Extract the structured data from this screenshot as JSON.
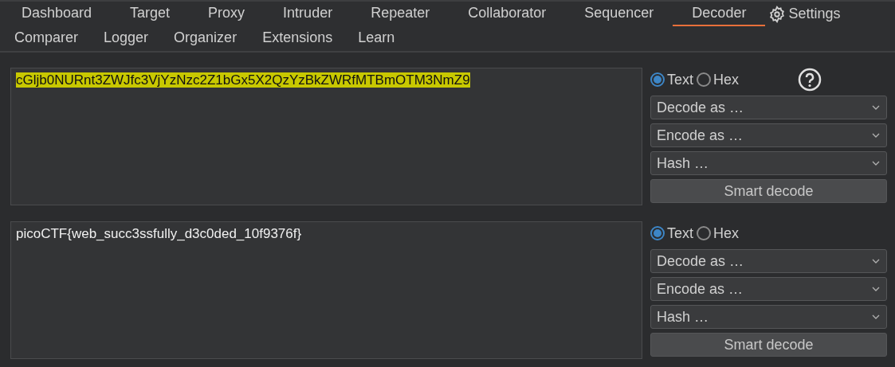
{
  "tabs_row_1": [
    {
      "label": "Dashboard",
      "selected": false
    },
    {
      "label": "Target",
      "selected": false
    },
    {
      "label": "Proxy",
      "selected": false
    },
    {
      "label": "Intruder",
      "selected": false
    },
    {
      "label": "Repeater",
      "selected": false
    },
    {
      "label": "Collaborator",
      "selected": false
    },
    {
      "label": "Sequencer",
      "selected": false
    },
    {
      "label": "Decoder",
      "selected": true
    }
  ],
  "settings": {
    "label": "Settings"
  },
  "tabs_row_2": [
    {
      "label": "Comparer",
      "selected": false
    },
    {
      "label": "Logger",
      "selected": false
    },
    {
      "label": "Organizer",
      "selected": false
    },
    {
      "label": "Extensions",
      "selected": false
    },
    {
      "label": "Learn",
      "selected": false
    }
  ],
  "panels": [
    {
      "text": "cGljb0NURnt3ZWJfc3VjYzNzc2Z1bGx5X2QzYzBkZWRfMTBmOTM3NmZ9",
      "highlighted": true,
      "formats": [
        {
          "label": "Text",
          "selected": true
        },
        {
          "label": "Hex",
          "selected": false
        }
      ],
      "help": true,
      "selects": [
        "Decode as …",
        "Encode as …",
        "Hash …"
      ],
      "button": "Smart decode"
    },
    {
      "text": "picoCTF{web_succ3ssfully_d3c0ded_10f9376f}",
      "highlighted": false,
      "formats": [
        {
          "label": "Text",
          "selected": true
        },
        {
          "label": "Hex",
          "selected": false
        }
      ],
      "help": false,
      "selects": [
        "Decode as …",
        "Encode as …",
        "Hash …"
      ],
      "button": "Smart decode"
    }
  ]
}
